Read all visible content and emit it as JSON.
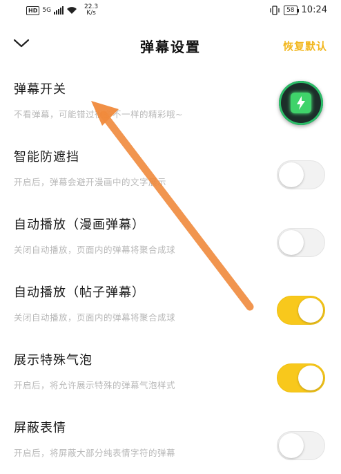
{
  "status_bar": {
    "hd_label": "HD",
    "network": "5G",
    "speed_value": "22.3",
    "speed_unit": "K/s",
    "battery": "58",
    "time": "10:24"
  },
  "header": {
    "back_icon": "chevron-down-icon",
    "title": "弹幕设置",
    "reset_label": "恢复默认"
  },
  "settings": [
    {
      "title": "弹幕开关",
      "subtitle": "不看弹幕，可能错过很多不一样的精彩哦~",
      "enabled": true
    },
    {
      "title": "智能防遮挡",
      "subtitle": "开启后，弹幕会避开漫画中的文字展示",
      "enabled": false
    },
    {
      "title": "自动播放（漫画弹幕）",
      "subtitle": "关闭自动播放，页面内的弹幕将聚合成球",
      "enabled": false
    },
    {
      "title": "自动播放（帖子弹幕）",
      "subtitle": "关闭自动播放，页面内的弹幕将聚合成球",
      "enabled": true
    },
    {
      "title": "展示特殊气泡",
      "subtitle": "开启后，将允许展示特殊的弹幕气泡样式",
      "enabled": true
    },
    {
      "title": "屏蔽表情",
      "subtitle": "开启后，将屏蔽大部分纯表情字符的弹幕",
      "enabled": false
    }
  ],
  "floating_button": {
    "icon": "download-box-icon"
  },
  "colors": {
    "accent": "#f8c81c",
    "reset_text": "#f2b71f",
    "annotation_arrow": "#f08a3c"
  }
}
